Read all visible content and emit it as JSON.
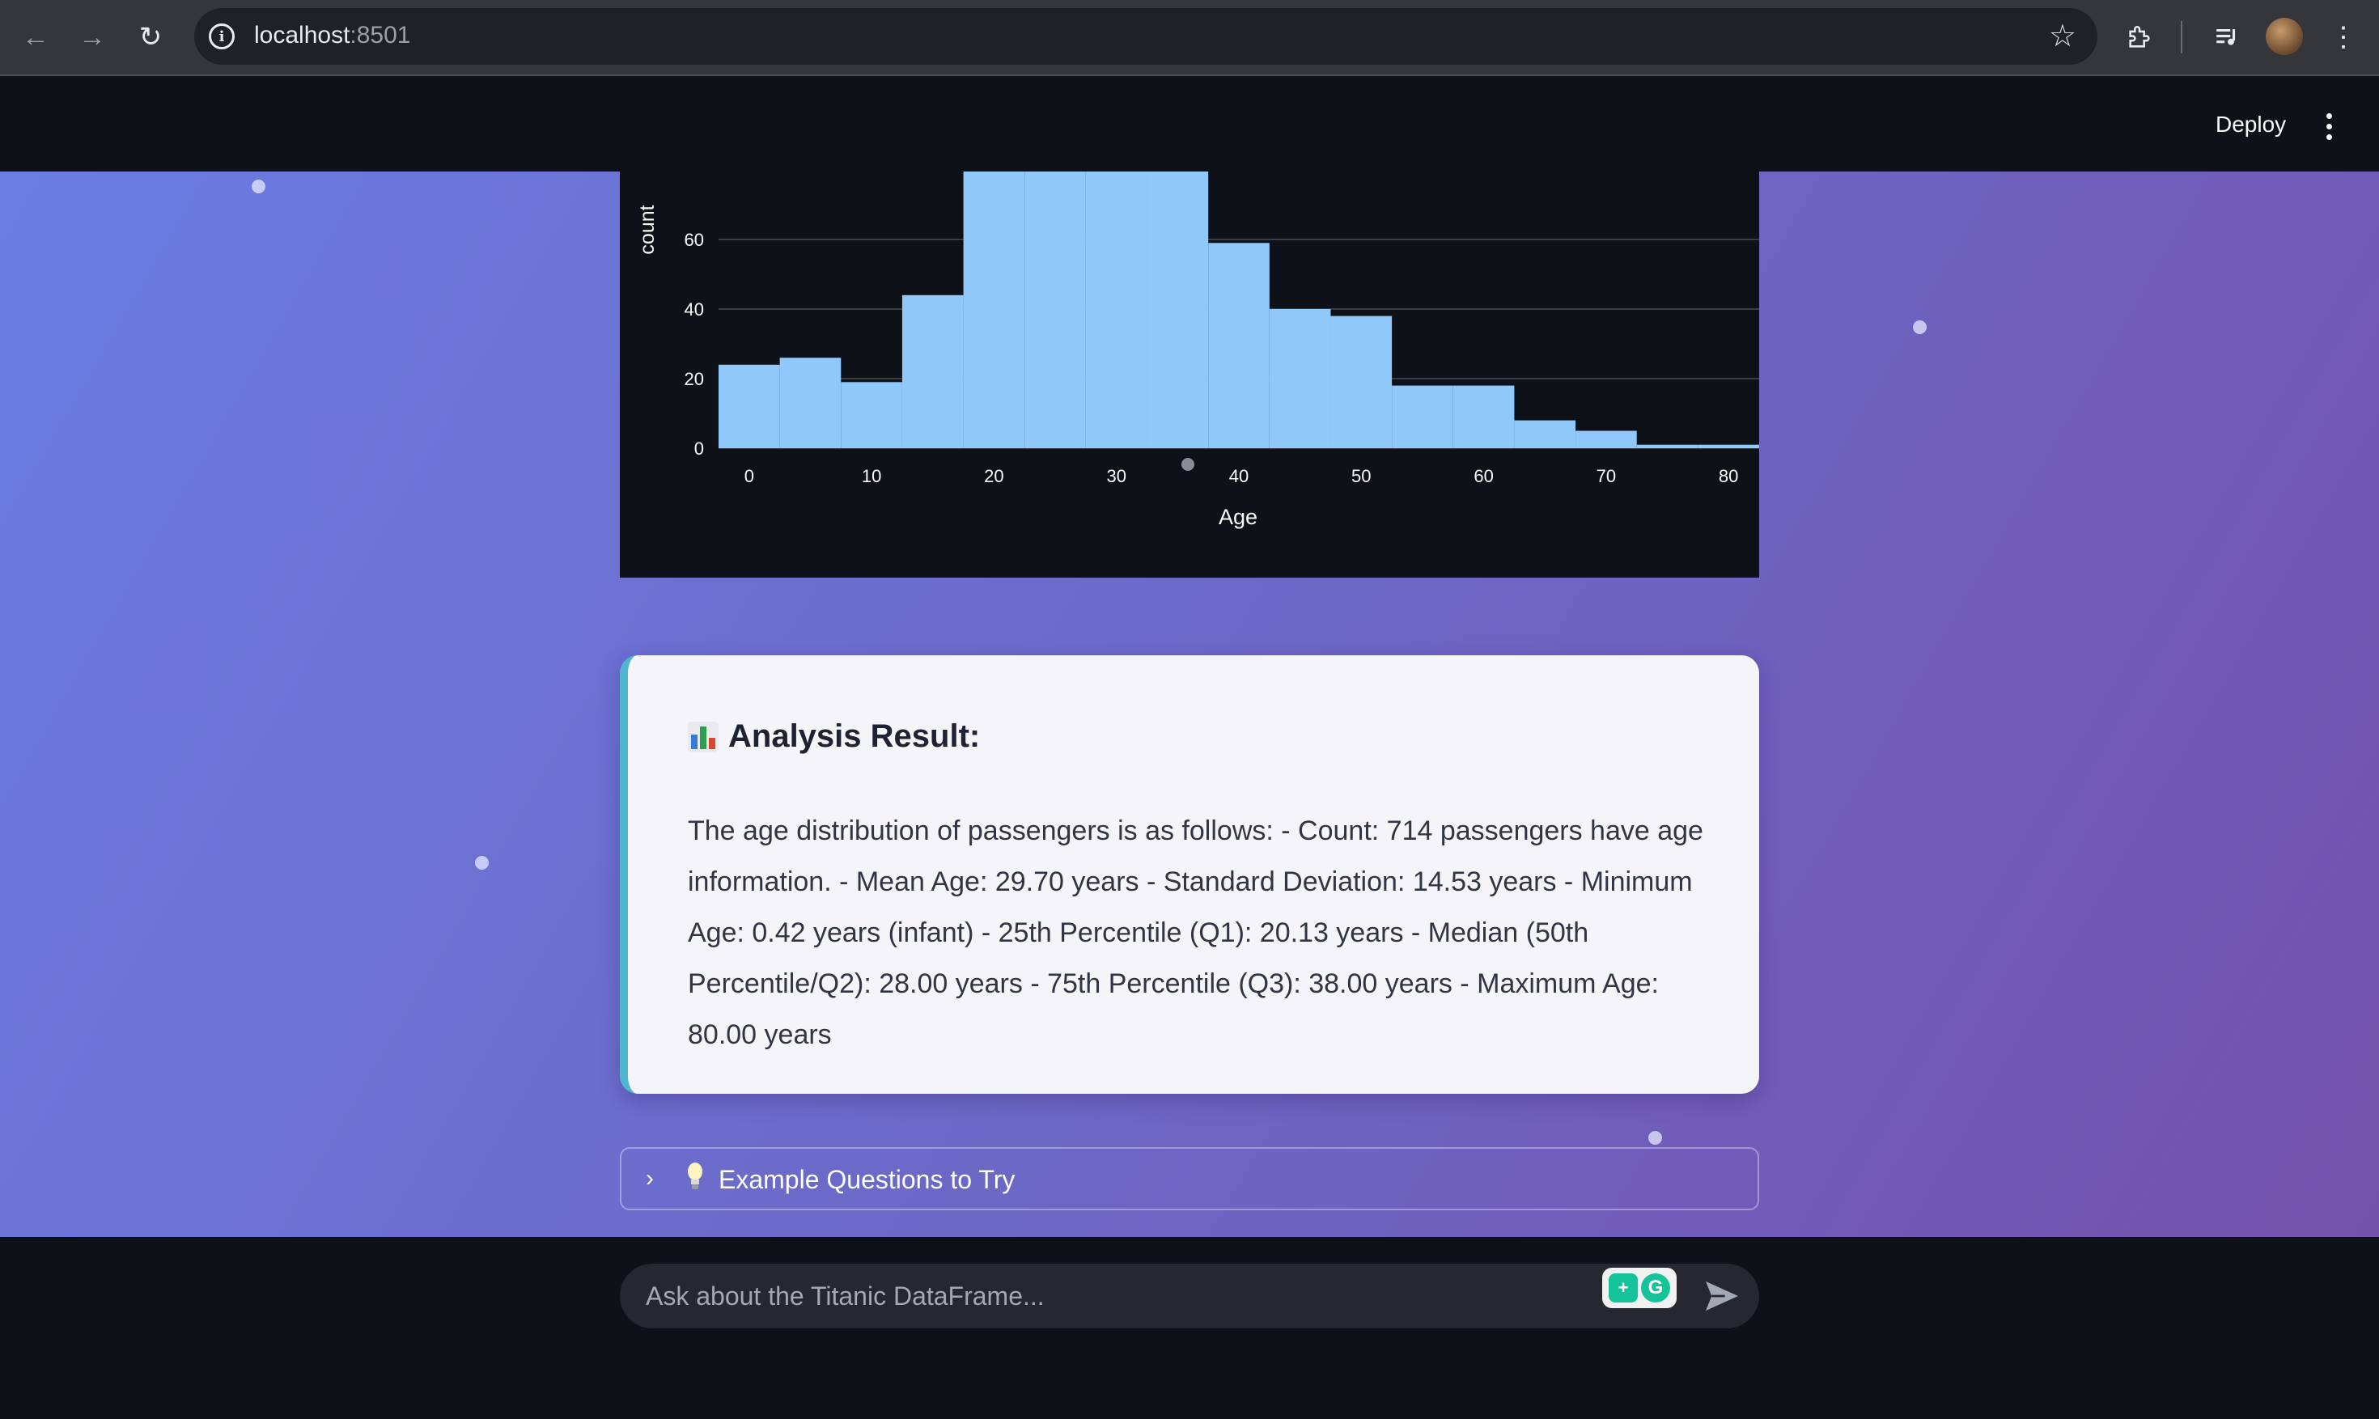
{
  "browser": {
    "url_host": "localhost",
    "url_port": ":8501"
  },
  "header": {
    "deploy_label": "Deploy"
  },
  "chart_data": {
    "type": "bar",
    "xlabel": "Age",
    "ylabel": "count",
    "x_ticks": [
      "0",
      "10",
      "20",
      "30",
      "40",
      "50",
      "60",
      "70",
      "80"
    ],
    "y_ticks": [
      "0",
      "20",
      "40",
      "60"
    ],
    "bins": [
      {
        "start": -2.5,
        "end": 2.5,
        "count": 24
      },
      {
        "start": 2.5,
        "end": 7.5,
        "count": 26
      },
      {
        "start": 7.5,
        "end": 12.5,
        "count": 19
      },
      {
        "start": 12.5,
        "end": 17.5,
        "count": 44
      },
      {
        "start": 17.5,
        "end": 22.5,
        "count": 80
      },
      {
        "start": 22.5,
        "end": 27.5,
        "count": 80
      },
      {
        "start": 27.5,
        "end": 32.5,
        "count": 80
      },
      {
        "start": 32.5,
        "end": 37.5,
        "count": 80
      },
      {
        "start": 37.5,
        "end": 42.5,
        "count": 59
      },
      {
        "start": 42.5,
        "end": 47.5,
        "count": 40
      },
      {
        "start": 47.5,
        "end": 52.5,
        "count": 38
      },
      {
        "start": 52.5,
        "end": 57.5,
        "count": 18
      },
      {
        "start": 57.5,
        "end": 62.5,
        "count": 18
      },
      {
        "start": 62.5,
        "end": 67.5,
        "count": 8
      },
      {
        "start": 67.5,
        "end": 72.5,
        "count": 5
      },
      {
        "start": 72.5,
        "end": 77.5,
        "count": 1
      },
      {
        "start": 77.5,
        "end": 82.5,
        "count": 1
      }
    ],
    "xlim": [
      -2.5,
      82.5
    ],
    "ylim": [
      0,
      80
    ],
    "grid": true,
    "colors": {
      "bar": "#90c9f9",
      "grid": "#3a3d46",
      "background": "#0e1117"
    }
  },
  "result": {
    "title": "Analysis Result:",
    "body": "The age distribution of passengers is as follows: - Count: 714 passengers have age information. - Mean Age: 29.70 years - Standard Deviation: 14.53 years - Minimum Age: 0.42 years (infant) - 25th Percentile (Q1): 20.13 years - Median (50th Percentile/Q2): 28.00 years - 75th Percentile (Q3): 38.00 years - Maximum Age: 80.00 years"
  },
  "expander": {
    "label": "Example Questions to Try"
  },
  "chat": {
    "placeholder": "Ask about the Titanic DataFrame..."
  }
}
